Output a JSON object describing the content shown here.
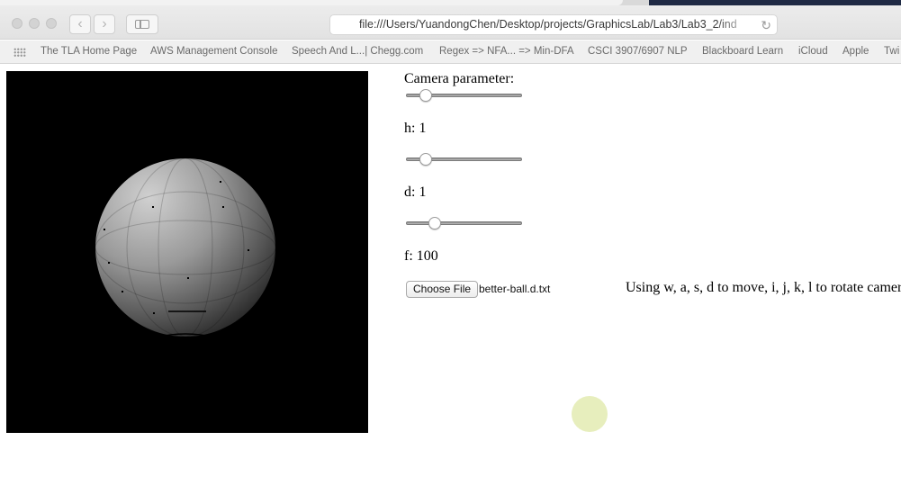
{
  "browser": {
    "url": "file:///Users/YuandongChen/Desktop/projects/GraphicsLab/Lab3/Lab3_2/ind",
    "back_icon": "chevron-left-icon",
    "forward_icon": "chevron-right-icon",
    "reload_icon": "reload-icon"
  },
  "bookmarks": [
    "The TLA Home Page",
    "AWS Management Console",
    "Speech And L...| Chegg.com",
    "Regex => NFA... => Min-DFA",
    "CSCI 3907/6907 NLP",
    "Blackboard Learn",
    "iCloud",
    "Apple",
    "Twi"
  ],
  "controls": {
    "camera_label": "Camera parameter:",
    "h_label": "h: 1",
    "d_label": "d: 1",
    "f_label": "f: 100",
    "camera_slider_fraction": 0.13,
    "h_slider_fraction": 0.13,
    "d_slider_fraction": 0.22,
    "choose_file_label": "Choose File",
    "file_name": "better-ball.d.txt",
    "hint": "Using w, a, s, d to move, i, j, k, l to rotate camer"
  },
  "colors": {
    "canvas_background": "#000000",
    "sphere_light": "#c8c8c8",
    "sphere_dark": "#2e2e2e",
    "cursor_highlight": "#e6edb9"
  }
}
